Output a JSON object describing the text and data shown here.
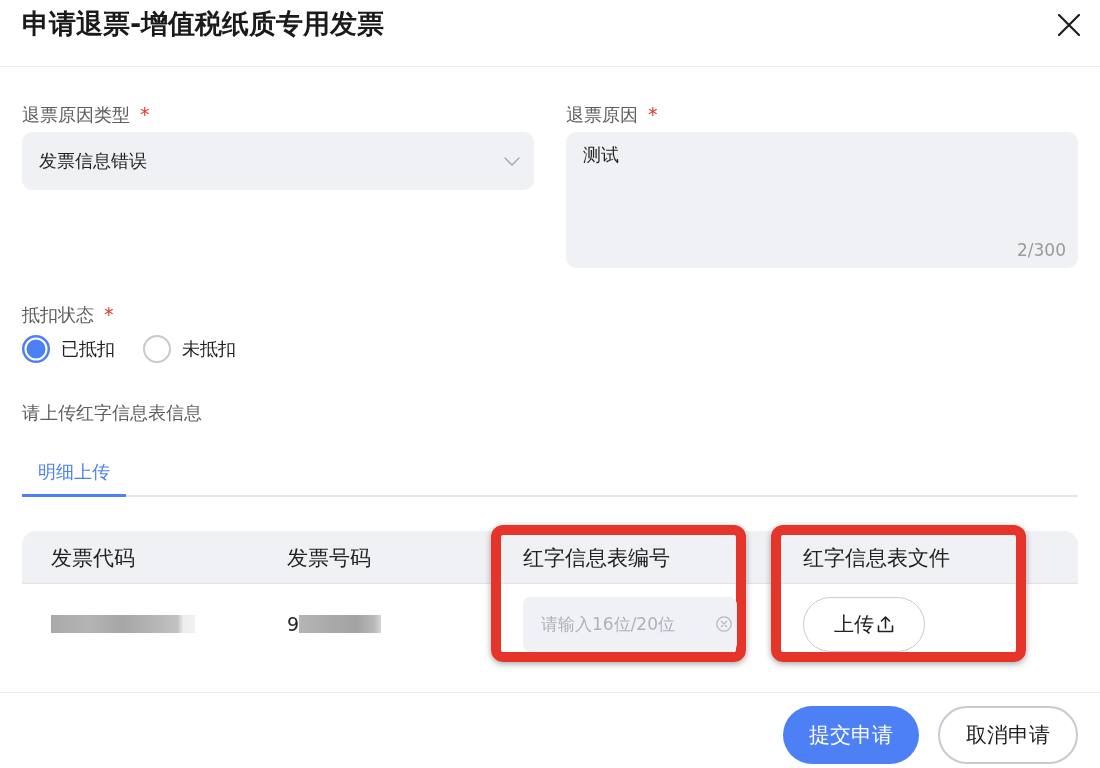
{
  "dialog": {
    "title": "申请退票-增值税纸质专用发票"
  },
  "form": {
    "reason_type": {
      "label": "退票原因类型",
      "required_mark": "*",
      "value": "发票信息错误"
    },
    "reason": {
      "label": "退票原因",
      "required_mark": "*",
      "value": "测试",
      "counter": "2/300"
    },
    "deduction_status": {
      "label": "抵扣状态",
      "required_mark": "*",
      "options": [
        {
          "label": "已抵扣",
          "selected": true
        },
        {
          "label": "未抵扣",
          "selected": false
        }
      ]
    }
  },
  "upload_section": {
    "label": "请上传红字信息表信息",
    "tabs": [
      {
        "label": "明细上传",
        "selected": true
      }
    ]
  },
  "table": {
    "columns": [
      {
        "label": "发票代码",
        "highlighted": false
      },
      {
        "label": "发票号码",
        "highlighted": false
      },
      {
        "label": "红字信息表编号",
        "highlighted": true
      },
      {
        "label": "红字信息表文件",
        "highlighted": true
      }
    ],
    "rows": [
      {
        "cells": [
          {
            "kind": "redacted"
          },
          {
            "kind": "redacted",
            "text": "9"
          },
          {
            "kind": "input",
            "placeholder": "请输入16位/20位"
          },
          {
            "kind": "upload",
            "label": "上传"
          }
        ]
      }
    ]
  },
  "footer": {
    "buttons": [
      {
        "label": "提交申请",
        "kind": "primary"
      },
      {
        "label": "取消申请",
        "kind": "secondary"
      }
    ]
  }
}
